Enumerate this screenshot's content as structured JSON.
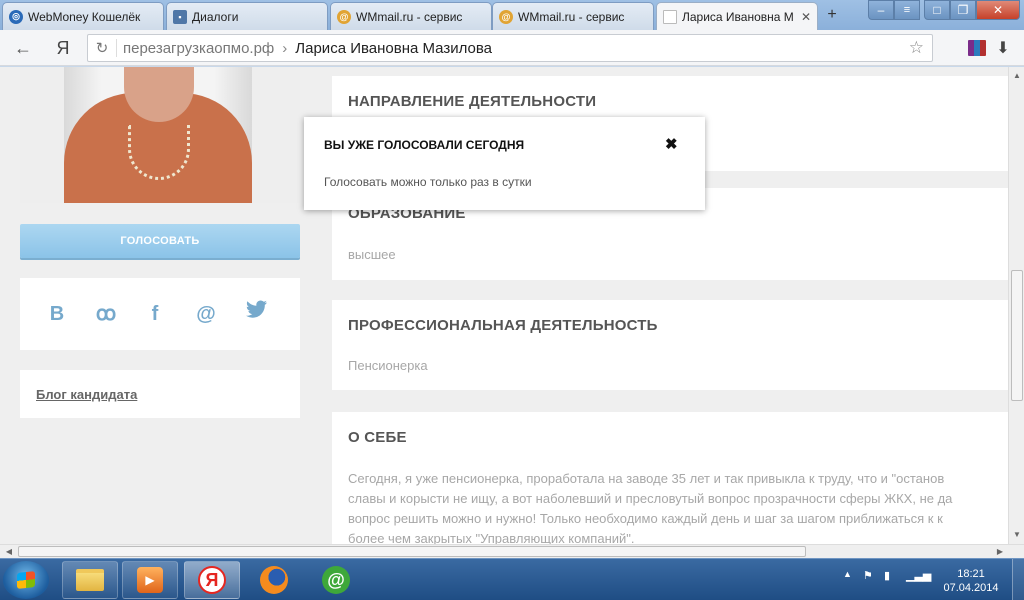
{
  "browser": {
    "tabs": [
      {
        "label": "WebMoney Кошелёк",
        "favicon_color": "#2a6ab8"
      },
      {
        "label": "Диалоги",
        "favicon_color": "#4f77a7"
      },
      {
        "label": "WMmail.ru - сервис",
        "favicon_color": "#e1a434"
      },
      {
        "label": "WMmail.ru - сервис",
        "favicon_color": "#e1a434"
      },
      {
        "label": "Лариса Ивановна М",
        "favicon_color": "#cfd4da",
        "active": true
      }
    ],
    "new_tab": "+",
    "window_controls": {
      "minimize": "–",
      "maximize": "□",
      "close": "✕"
    },
    "yandex_logo": "Я",
    "address": {
      "host": "перезагрузкаопмо.рф",
      "separator": "›",
      "page_title": "Лариса Ивановна Мазилова"
    }
  },
  "sidebar": {
    "vote_button": "ГОЛОСОВАТЬ",
    "social_icons": [
      {
        "name": "vk-icon",
        "glyph": "В"
      },
      {
        "name": "odnoklassniki-icon",
        "glyph": "ꝏ"
      },
      {
        "name": "facebook-icon",
        "glyph": "f"
      },
      {
        "name": "mail-icon",
        "glyph": "@"
      },
      {
        "name": "twitter-icon",
        "glyph": "🐦"
      }
    ],
    "blog_link": "Блог кандидата"
  },
  "profile": {
    "direction_heading": "НАПРАВЛЕНИЕ ДЕЯТЕЛЬНОСТИ",
    "education_heading": "ОБРАЗОВАНИЕ",
    "education_value": "высшее",
    "professional_heading": "ПРОФЕССИОНАЛЬНАЯ ДЕЯТЕЛЬНОСТЬ",
    "professional_value": "Пенсионерка",
    "about_heading": "О СЕБЕ",
    "about_lines": [
      "Сегодня, я уже пенсионерка, проработала на заводе 35 лет и так привыкла к труду, что и \"останов",
      "славы и корысти не ищу, а вот наболевший и пресловутый вопрос прозрачности сферы ЖКХ, не да",
      "вопрос решить можно и нужно! Только необходимо каждый день и шаг за шагом приближаться к к",
      "более чем закрытых \"Управляющих компаний\"."
    ]
  },
  "modal": {
    "title": "ВЫ УЖЕ ГОЛОСОВАЛИ СЕГОДНЯ",
    "message": "Голосовать можно только раз в сутки",
    "close_glyph": "✖"
  },
  "taskbar": {
    "time": "18:21",
    "date": "07.04.2014"
  }
}
